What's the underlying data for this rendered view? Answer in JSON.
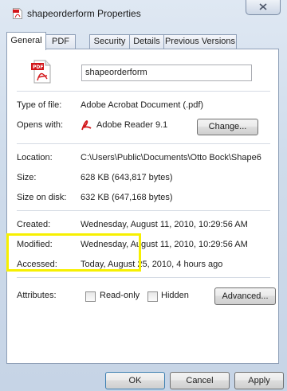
{
  "window": {
    "title": "shapeorderform Properties"
  },
  "tabs": [
    {
      "label": "General",
      "active": true
    },
    {
      "label": "PDF",
      "active": false
    },
    {
      "label": "Security",
      "active": false
    },
    {
      "label": "Details",
      "active": false
    },
    {
      "label": "Previous Versions",
      "active": false
    }
  ],
  "file": {
    "name": "shapeorderform"
  },
  "info": {
    "type_label": "Type of file:",
    "type_value": "Adobe Acrobat Document (.pdf)",
    "opens_label": "Opens with:",
    "opens_value": "Adobe Reader 9.1",
    "change_button": "Change...",
    "location_label": "Location:",
    "location_value": "C:\\Users\\Public\\Documents\\Otto Bock\\Shape6",
    "size_label": "Size:",
    "size_value": "628 KB (643,817 bytes)",
    "size_disk_label": "Size on disk:",
    "size_disk_value": "632 KB (647,168 bytes)",
    "created_label": "Created:",
    "created_value": "Wednesday, August 11, 2010, 10:29:56 AM",
    "modified_label": "Modified:",
    "modified_value": "Wednesday, August 11, 2010, 10:29:56 AM",
    "accessed_label": "Accessed:",
    "accessed_value": "Today, August 25, 2010, 4 hours ago"
  },
  "attributes": {
    "label": "Attributes:",
    "readonly_label": "Read-only",
    "readonly_checked": false,
    "hidden_label": "Hidden",
    "hidden_checked": false,
    "advanced_button": "Advanced..."
  },
  "footer": {
    "ok": "OK",
    "cancel": "Cancel",
    "apply": "Apply"
  },
  "colors": {
    "highlight": "#f7f000",
    "pdf_red": "#d2161a"
  }
}
